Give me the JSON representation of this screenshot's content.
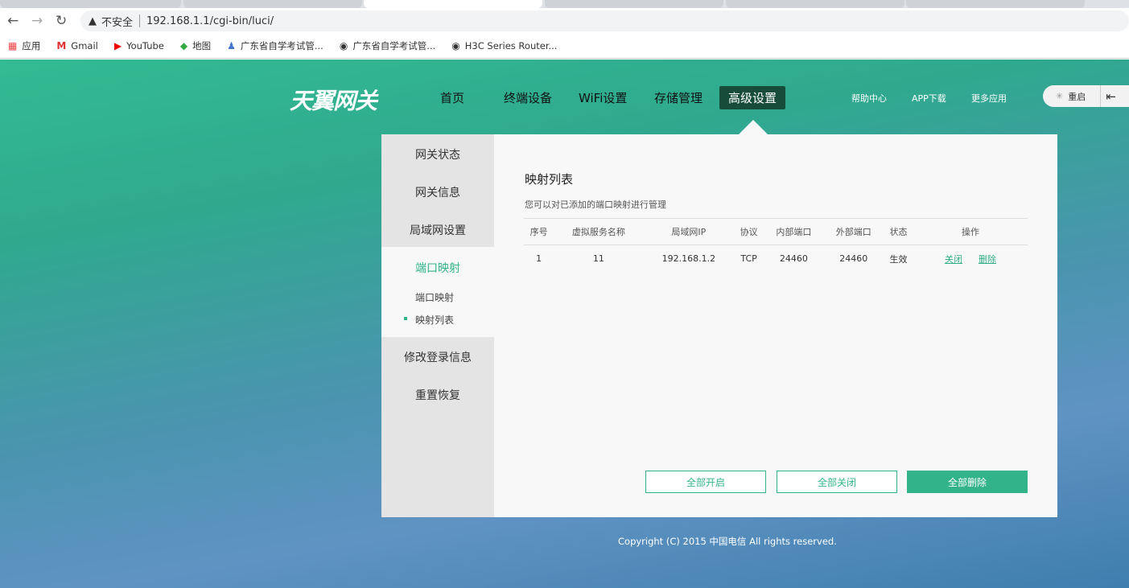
{
  "browser": {
    "security": "不安全",
    "url": "192.168.1.1/cgi-bin/luci/",
    "bookmarks": [
      "应用",
      "Gmail",
      "YouTube",
      "地图",
      "广东省自学考试管...",
      "广东省自学考试管...",
      "H3C Series Router..."
    ]
  },
  "header": {
    "logo": "天翼网关",
    "menu": [
      "首页",
      "终端设备",
      "WiFi设置",
      "存储管理",
      "高级设置"
    ],
    "links": [
      "帮助中心",
      "APP下载",
      "更多应用"
    ],
    "restart": "重启"
  },
  "sidebar": {
    "items": [
      "网关状态",
      "网关信息",
      "局域网设置",
      "端口映射",
      "修改登录信息",
      "重置恢复"
    ],
    "sub": [
      "端口映射",
      "映射列表"
    ]
  },
  "main": {
    "title": "映射列表",
    "desc": "您可以对已添加的端口映射进行管理",
    "columns": [
      "序号",
      "虚拟服务名称",
      "局域网IP",
      "协议",
      "内部端口",
      "外部端口",
      "状态",
      "操作"
    ],
    "rows": [
      {
        "no": "1",
        "name": "11",
        "ip": "192.168.1.2",
        "proto": "TCP",
        "inner": "24460",
        "outer": "24460",
        "status": "生效",
        "close": "关闭",
        "del": "删除"
      }
    ],
    "buttons": [
      "全部开启",
      "全部关闭",
      "全部删除"
    ]
  },
  "footer": "Copyright (C) 2015 中国电信 All rights reserved.",
  "colors": {
    "accent": "#33b38a",
    "active_menu": "#174c3a"
  }
}
